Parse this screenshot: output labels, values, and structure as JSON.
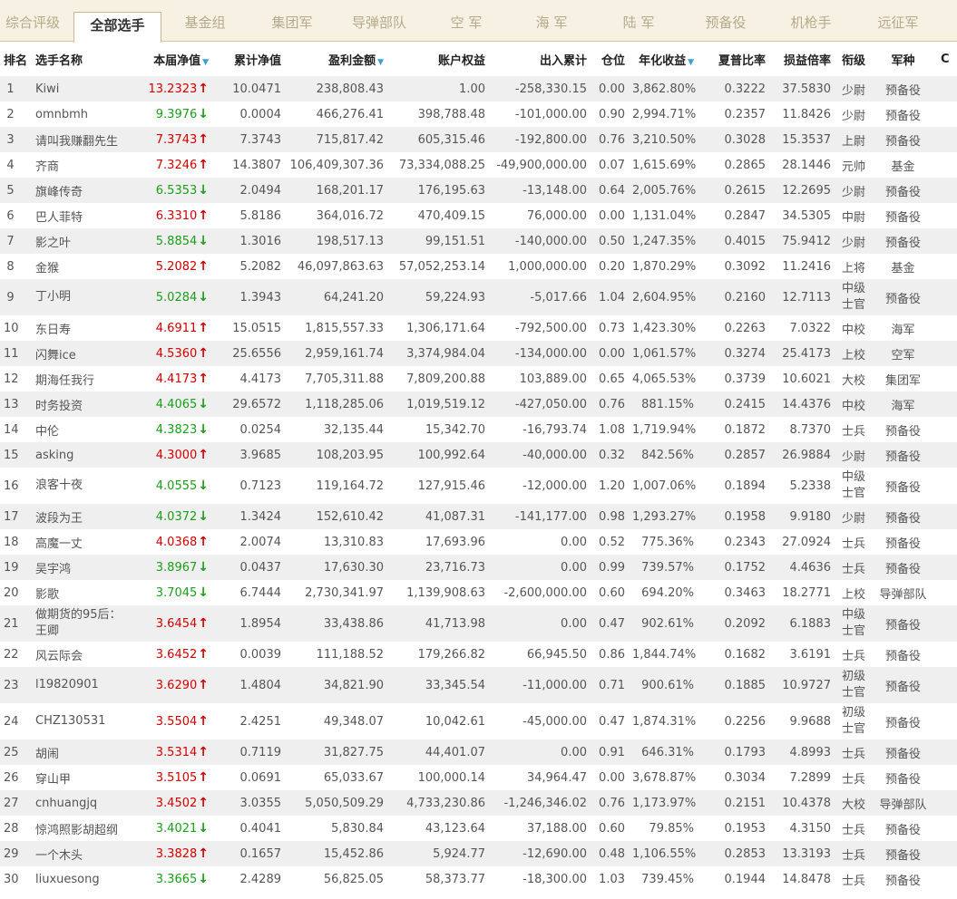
{
  "tabs": [
    {
      "label": "综合评级",
      "active": false
    },
    {
      "label": "全部选手",
      "active": true
    },
    {
      "label": "基金组",
      "active": false
    },
    {
      "label": "集团军",
      "active": false
    },
    {
      "label": "导弹部队",
      "active": false
    },
    {
      "label": "空  军",
      "active": false
    },
    {
      "label": "海  军",
      "active": false
    },
    {
      "label": "陆  军",
      "active": false
    },
    {
      "label": "预备役",
      "active": false
    },
    {
      "label": "机枪手",
      "active": false
    },
    {
      "label": "远征军",
      "active": false
    }
  ],
  "table": {
    "headers": [
      "排名",
      "选手名称",
      "本届净值",
      "累计净值",
      "盈利金额",
      "账户权益",
      "出入累计",
      "仓位",
      "年化收益",
      "夏普比率",
      "损益倍率",
      "衔级",
      "军种",
      "C"
    ],
    "sort_arrow": "▼",
    "colors": {
      "up": "#d40000",
      "down": "#1a9f1a",
      "sort": "#3a9fd8"
    },
    "rows": [
      {
        "rank": "1",
        "name": "Kiwi",
        "nav": "13.2323",
        "dir": "up",
        "cum": "10.0471",
        "profit": "238,808.43",
        "equity": "1.00",
        "flow": "-258,330.15",
        "pos": "0.00",
        "annual": "3,862.80%",
        "sharpe": "0.3222",
        "pl": "37.5830",
        "grade": "少尉",
        "branch": "预备役"
      },
      {
        "rank": "2",
        "name": "omnbmh",
        "nav": "9.3976",
        "dir": "down",
        "cum": "0.0004",
        "profit": "466,276.41",
        "equity": "398,788.48",
        "flow": "-101,000.00",
        "pos": "0.90",
        "annual": "2,994.71%",
        "sharpe": "0.2357",
        "pl": "11.8426",
        "grade": "少尉",
        "branch": "预备役"
      },
      {
        "rank": "3",
        "name": "请叫我赚翻先生",
        "nav": "7.3743",
        "dir": "up",
        "cum": "7.3743",
        "profit": "715,817.42",
        "equity": "605,315.46",
        "flow": "-192,800.00",
        "pos": "0.76",
        "annual": "3,210.50%",
        "sharpe": "0.3028",
        "pl": "15.3537",
        "grade": "上尉",
        "branch": "预备役"
      },
      {
        "rank": "4",
        "name": "齐商",
        "nav": "7.3246",
        "dir": "up",
        "cum": "14.3807",
        "profit": "106,409,307.36",
        "equity": "73,334,088.25",
        "flow": "-49,900,000.00",
        "pos": "0.07",
        "annual": "1,615.69%",
        "sharpe": "0.2865",
        "pl": "28.1446",
        "grade": "元帅",
        "branch": "基金"
      },
      {
        "rank": "5",
        "name": "旗峰传奇",
        "nav": "6.5353",
        "dir": "down",
        "cum": "2.0494",
        "profit": "168,201.17",
        "equity": "176,195.63",
        "flow": "-13,148.00",
        "pos": "0.64",
        "annual": "2,005.76%",
        "sharpe": "0.2615",
        "pl": "12.2695",
        "grade": "少尉",
        "branch": "预备役"
      },
      {
        "rank": "6",
        "name": "巴人菲特",
        "nav": "6.3310",
        "dir": "up",
        "cum": "5.8186",
        "profit": "364,016.72",
        "equity": "470,409.15",
        "flow": "76,000.00",
        "pos": "0.00",
        "annual": "1,131.04%",
        "sharpe": "0.2847",
        "pl": "34.5305",
        "grade": "中尉",
        "branch": "预备役"
      },
      {
        "rank": "7",
        "name": "影之叶",
        "nav": "5.8854",
        "dir": "down",
        "cum": "1.3016",
        "profit": "198,517.13",
        "equity": "99,151.51",
        "flow": "-140,000.00",
        "pos": "0.50",
        "annual": "1,247.35%",
        "sharpe": "0.4015",
        "pl": "75.9412",
        "grade": "少尉",
        "branch": "预备役"
      },
      {
        "rank": "8",
        "name": "金猴",
        "nav": "5.2082",
        "dir": "up",
        "cum": "5.2082",
        "profit": "46,097,863.63",
        "equity": "57,052,253.14",
        "flow": "1,000,000.00",
        "pos": "0.20",
        "annual": "1,870.29%",
        "sharpe": "0.3092",
        "pl": "11.2416",
        "grade": "上将",
        "branch": "基金"
      },
      {
        "rank": "9",
        "name": "丁小明",
        "nav": "5.0284",
        "dir": "down",
        "cum": "1.3943",
        "profit": "64,241.20",
        "equity": "59,224.93",
        "flow": "-5,017.66",
        "pos": "1.04",
        "annual": "2,604.95%",
        "sharpe": "0.2160",
        "pl": "12.7113",
        "grade": "中级士官",
        "branch": "预备役",
        "tall": true
      },
      {
        "rank": "10",
        "name": "东日寿",
        "nav": "4.6911",
        "dir": "up",
        "cum": "15.0515",
        "profit": "1,815,557.33",
        "equity": "1,306,171.64",
        "flow": "-792,500.00",
        "pos": "0.73",
        "annual": "1,423.30%",
        "sharpe": "0.2263",
        "pl": "7.0322",
        "grade": "中校",
        "branch": "海军"
      },
      {
        "rank": "11",
        "name": "闪舞ice",
        "nav": "4.5360",
        "dir": "up",
        "cum": "25.6556",
        "profit": "2,959,161.74",
        "equity": "3,374,984.04",
        "flow": "-134,000.00",
        "pos": "0.00",
        "annual": "1,061.57%",
        "sharpe": "0.3274",
        "pl": "25.4173",
        "grade": "上校",
        "branch": "空军"
      },
      {
        "rank": "12",
        "name": "期海任我行",
        "nav": "4.4173",
        "dir": "up",
        "cum": "4.4173",
        "profit": "7,705,311.88",
        "equity": "7,809,200.88",
        "flow": "103,889.00",
        "pos": "0.65",
        "annual": "4,065.53%",
        "sharpe": "0.3739",
        "pl": "10.6021",
        "grade": "大校",
        "branch": "集团军"
      },
      {
        "rank": "13",
        "name": "时务投资",
        "nav": "4.4065",
        "dir": "down",
        "cum": "29.6572",
        "profit": "1,118,285.06",
        "equity": "1,019,519.12",
        "flow": "-427,050.00",
        "pos": "0.76",
        "annual": "881.15%",
        "sharpe": "0.2415",
        "pl": "14.4376",
        "grade": "中校",
        "branch": "海军"
      },
      {
        "rank": "14",
        "name": "中伦",
        "nav": "4.3823",
        "dir": "down",
        "cum": "0.0254",
        "profit": "32,135.44",
        "equity": "15,342.70",
        "flow": "-16,793.74",
        "pos": "1.08",
        "annual": "1,719.94%",
        "sharpe": "0.1872",
        "pl": "8.7370",
        "grade": "士兵",
        "branch": "预备役"
      },
      {
        "rank": "15",
        "name": "asking",
        "nav": "4.3000",
        "dir": "up",
        "cum": "3.9685",
        "profit": "108,203.95",
        "equity": "100,992.64",
        "flow": "-40,000.00",
        "pos": "0.32",
        "annual": "842.56%",
        "sharpe": "0.2857",
        "pl": "26.9884",
        "grade": "少尉",
        "branch": "预备役"
      },
      {
        "rank": "16",
        "name": "浪客十夜",
        "nav": "4.0555",
        "dir": "down",
        "cum": "0.7123",
        "profit": "119,164.72",
        "equity": "127,915.46",
        "flow": "-12,000.00",
        "pos": "1.20",
        "annual": "1,007.06%",
        "sharpe": "0.1894",
        "pl": "5.2338",
        "grade": "中级士官",
        "branch": "预备役",
        "tall": true
      },
      {
        "rank": "17",
        "name": "波段为王",
        "nav": "4.0372",
        "dir": "down",
        "cum": "1.3424",
        "profit": "152,610.42",
        "equity": "41,087.31",
        "flow": "-141,177.00",
        "pos": "0.98",
        "annual": "1,293.27%",
        "sharpe": "0.1958",
        "pl": "9.9180",
        "grade": "少尉",
        "branch": "预备役"
      },
      {
        "rank": "18",
        "name": "高魔一丈",
        "nav": "4.0368",
        "dir": "up",
        "cum": "2.0074",
        "profit": "13,310.83",
        "equity": "17,693.96",
        "flow": "0.00",
        "pos": "0.52",
        "annual": "775.36%",
        "sharpe": "0.2343",
        "pl": "27.0924",
        "grade": "士兵",
        "branch": "预备役"
      },
      {
        "rank": "19",
        "name": "吴宇鸿",
        "nav": "3.8967",
        "dir": "down",
        "cum": "0.0437",
        "profit": "17,630.30",
        "equity": "23,716.73",
        "flow": "0.00",
        "pos": "0.99",
        "annual": "739.57%",
        "sharpe": "0.1752",
        "pl": "4.4636",
        "grade": "士兵",
        "branch": "预备役"
      },
      {
        "rank": "20",
        "name": "影歌",
        "nav": "3.7045",
        "dir": "down",
        "cum": "6.7444",
        "profit": "2,730,341.97",
        "equity": "1,139,908.63",
        "flow": "-2,600,000.00",
        "pos": "0.60",
        "annual": "694.20%",
        "sharpe": "0.3463",
        "pl": "18.2771",
        "grade": "上校",
        "branch": "导弹部队"
      },
      {
        "rank": "21",
        "name": "做期货的95后：王卿",
        "nav": "3.6454",
        "dir": "up",
        "cum": "1.8954",
        "profit": "33,438.86",
        "equity": "41,713.98",
        "flow": "0.00",
        "pos": "0.47",
        "annual": "902.61%",
        "sharpe": "0.2092",
        "pl": "6.1883",
        "grade": "中级士官",
        "branch": "预备役",
        "tall": true
      },
      {
        "rank": "22",
        "name": "风云际会",
        "nav": "3.6452",
        "dir": "up",
        "cum": "0.0039",
        "profit": "111,188.52",
        "equity": "179,266.82",
        "flow": "66,945.50",
        "pos": "0.86",
        "annual": "1,844.74%",
        "sharpe": "0.1682",
        "pl": "3.6191",
        "grade": "士兵",
        "branch": "预备役"
      },
      {
        "rank": "23",
        "name": "l19820901",
        "nav": "3.6290",
        "dir": "up",
        "cum": "1.4804",
        "profit": "34,821.90",
        "equity": "33,345.54",
        "flow": "-11,000.00",
        "pos": "0.71",
        "annual": "900.61%",
        "sharpe": "0.1885",
        "pl": "10.9727",
        "grade": "初级士官",
        "branch": "预备役",
        "tall": true
      },
      {
        "rank": "24",
        "name": "CHZ130531",
        "nav": "3.5504",
        "dir": "up",
        "cum": "2.4251",
        "profit": "49,348.07",
        "equity": "10,042.61",
        "flow": "-45,000.00",
        "pos": "0.47",
        "annual": "1,874.31%",
        "sharpe": "0.2256",
        "pl": "9.9688",
        "grade": "初级士官",
        "branch": "预备役",
        "tall": true
      },
      {
        "rank": "25",
        "name": "胡闹",
        "nav": "3.5314",
        "dir": "up",
        "cum": "0.7119",
        "profit": "31,827.75",
        "equity": "44,401.07",
        "flow": "0.00",
        "pos": "0.91",
        "annual": "646.31%",
        "sharpe": "0.1793",
        "pl": "4.8993",
        "grade": "士兵",
        "branch": "预备役"
      },
      {
        "rank": "26",
        "name": "穿山甲",
        "nav": "3.5105",
        "dir": "up",
        "cum": "0.0691",
        "profit": "65,033.67",
        "equity": "100,000.14",
        "flow": "34,964.47",
        "pos": "0.00",
        "annual": "3,678.87%",
        "sharpe": "0.3034",
        "pl": "7.2899",
        "grade": "士兵",
        "branch": "预备役"
      },
      {
        "rank": "27",
        "name": "cnhuangjq",
        "nav": "3.4502",
        "dir": "up",
        "cum": "3.0355",
        "profit": "5,050,509.29",
        "equity": "4,733,230.86",
        "flow": "-1,246,346.02",
        "pos": "0.76",
        "annual": "1,173.97%",
        "sharpe": "0.2151",
        "pl": "10.4378",
        "grade": "大校",
        "branch": "导弹部队"
      },
      {
        "rank": "28",
        "name": "惊鸿照影胡超纲",
        "nav": "3.4021",
        "dir": "down",
        "cum": "0.4041",
        "profit": "5,830.84",
        "equity": "43,123.64",
        "flow": "37,188.00",
        "pos": "0.60",
        "annual": "79.85%",
        "sharpe": "0.1953",
        "pl": "4.3150",
        "grade": "士兵",
        "branch": "预备役"
      },
      {
        "rank": "29",
        "name": "一个木头",
        "nav": "3.3828",
        "dir": "up",
        "cum": "0.1657",
        "profit": "15,452.86",
        "equity": "5,924.77",
        "flow": "-12,690.00",
        "pos": "0.48",
        "annual": "1,106.55%",
        "sharpe": "0.2853",
        "pl": "13.3193",
        "grade": "士兵",
        "branch": "预备役"
      },
      {
        "rank": "30",
        "name": "liuxuesong",
        "nav": "3.3665",
        "dir": "down",
        "cum": "2.4289",
        "profit": "56,825.05",
        "equity": "58,373.77",
        "flow": "-18,300.00",
        "pos": "1.03",
        "annual": "739.45%",
        "sharpe": "0.1944",
        "pl": "14.8478",
        "grade": "士兵",
        "branch": "预备役"
      }
    ]
  }
}
